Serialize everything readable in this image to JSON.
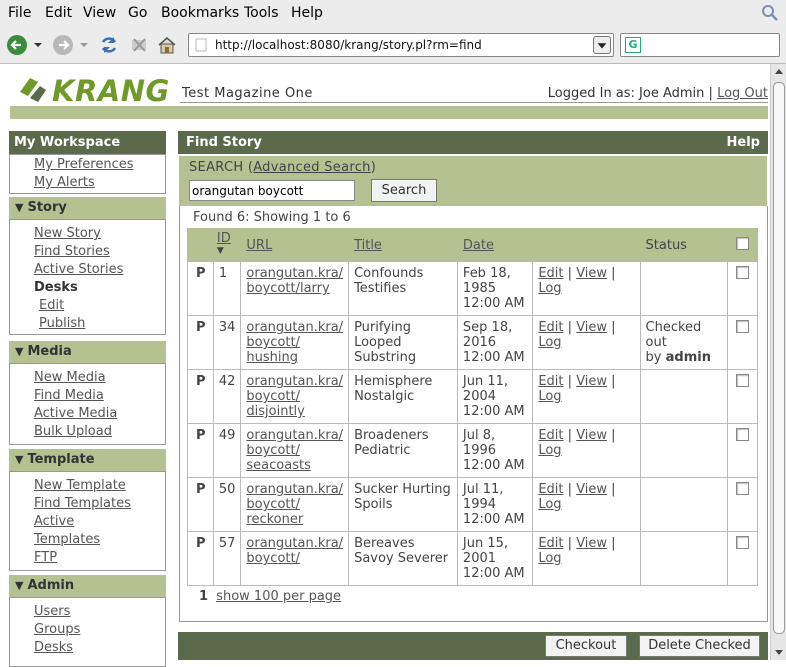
{
  "browser": {
    "menu": [
      "File",
      "Edit",
      "View",
      "Go",
      "Bookmarks",
      "Tools",
      "Help"
    ],
    "url": "http://localhost:8080/krang/story.pl?rm=find"
  },
  "header": {
    "logo_text": "KRANG",
    "publication": "Test Magazine One",
    "logged_in_prefix": "Logged In as: Joe Admin |",
    "logout": "Log Out"
  },
  "sidebar": {
    "workspace_title": "My Workspace",
    "workspace_links": [
      "My Preferences",
      "My Alerts"
    ],
    "story": {
      "title": "Story",
      "links": [
        "New Story",
        "Find Stories",
        "Active Stories"
      ],
      "desks_label": "Desks",
      "desk_links": [
        "Edit",
        "Publish"
      ]
    },
    "media": {
      "title": "Media",
      "links": [
        "New Media",
        "Find Media",
        "Active Media",
        "Bulk Upload"
      ]
    },
    "template": {
      "title": "Template",
      "links": [
        "New Template",
        "Find Templates",
        "Active",
        "Templates",
        "FTP"
      ]
    },
    "admin": {
      "title": "Admin",
      "links": [
        "Users",
        "Groups",
        "Desks"
      ]
    }
  },
  "main": {
    "title": "Find Story",
    "help": "Help",
    "search_label": "SEARCH (",
    "advanced_search": "Advanced Search",
    "search_label_end": ")",
    "search_value": "orangutan boycott",
    "search_button": "Search",
    "found_text": "Found 6: Showing 1 to 6",
    "columns": {
      "id": "ID",
      "url": "URL",
      "title": "Title",
      "date": "Date",
      "status": "Status"
    },
    "rows": [
      {
        "p": "P",
        "id": "1",
        "url1": "orangutan.kra/",
        "url2": "boycott/larry",
        "url3": "",
        "title1": "Confounds",
        "title2": "Testifies",
        "title3": "",
        "date1": "Feb 18,",
        "date2": "1985",
        "date3": "12:00 AM",
        "status1": "",
        "status2": "",
        "status_user": ""
      },
      {
        "p": "P",
        "id": "34",
        "url1": "orangutan.kra/",
        "url2": "boycott/",
        "url3": "hushing",
        "title1": "Purifying",
        "title2": "Looped",
        "title3": "Substring",
        "date1": "Sep 18,",
        "date2": "2016",
        "date3": "12:00 AM",
        "status1": "Checked out",
        "status2": "by ",
        "status_user": "admin"
      },
      {
        "p": "P",
        "id": "42",
        "url1": "orangutan.kra/",
        "url2": "boycott/",
        "url3": "disjointly",
        "title1": "Hemisphere",
        "title2": "Nostalgic",
        "title3": "",
        "date1": "Jun 11,",
        "date2": "2004",
        "date3": "12:00 AM",
        "status1": "",
        "status2": "",
        "status_user": ""
      },
      {
        "p": "P",
        "id": "49",
        "url1": "orangutan.kra/",
        "url2": "boycott/",
        "url3": "seacoasts",
        "title1": "Broadeners",
        "title2": "Pediatric",
        "title3": "",
        "date1": "Jul 8, 1996",
        "date2": "12:00 AM",
        "date3": "",
        "status1": "",
        "status2": "",
        "status_user": ""
      },
      {
        "p": "P",
        "id": "50",
        "url1": "orangutan.kra/",
        "url2": "boycott/",
        "url3": "reckoner",
        "title1": "Sucker Hurting",
        "title2": "Spoils",
        "title3": "",
        "date1": "Jul 11,",
        "date2": "1994",
        "date3": "12:00 AM",
        "status1": "",
        "status2": "",
        "status_user": ""
      },
      {
        "p": "P",
        "id": "57",
        "url1": "orangutan.kra/",
        "url2": "boycott/",
        "url3": "",
        "title1": "Bereaves",
        "title2": "Savoy Severer",
        "title3": "",
        "date1": "Jun 15,",
        "date2": "2001",
        "date3": "12:00 AM",
        "status1": "",
        "status2": "",
        "status_user": ""
      }
    ],
    "row_actions": [
      "Edit",
      "View",
      "Log"
    ],
    "pager_page": "1",
    "pager_link": "show 100 per page",
    "checkout_button": "Checkout",
    "delete_button": "Delete Checked"
  },
  "colors": {
    "dark_green": "#5a6a4a",
    "light_green": "#b5c191",
    "logo_green": "#6f9a2a"
  }
}
